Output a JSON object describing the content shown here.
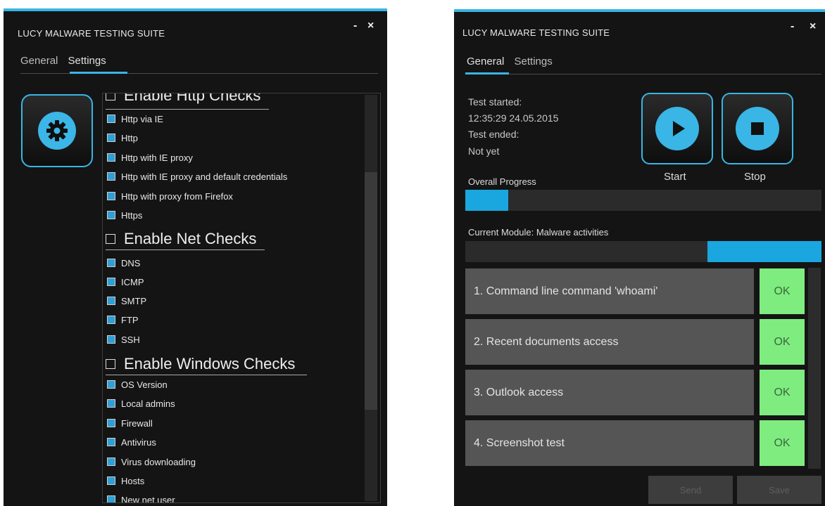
{
  "left_window": {
    "title": "LUCY MALWARE TESTING SUITE",
    "minimize": "-",
    "close": "×",
    "tabs": [
      {
        "label": "General"
      },
      {
        "label": "Settings"
      }
    ],
    "active_tab": "Settings",
    "settings_icon": "gear-icon",
    "sections": [
      {
        "header": "Enable Http Checks",
        "enabled": false,
        "items": [
          {
            "label": "Http via IE",
            "checked": true
          },
          {
            "label": "Http",
            "checked": true
          },
          {
            "label": "Http with IE proxy",
            "checked": true
          },
          {
            "label": "Http with IE proxy and default credentials",
            "checked": true
          },
          {
            "label": "Http with proxy from Firefox",
            "checked": true
          },
          {
            "label": "Https",
            "checked": true
          }
        ]
      },
      {
        "header": "Enable Net Checks",
        "enabled": false,
        "items": [
          {
            "label": "DNS",
            "checked": true
          },
          {
            "label": "ICMP",
            "checked": true
          },
          {
            "label": "SMTP",
            "checked": true
          },
          {
            "label": "FTP",
            "checked": true
          },
          {
            "label": "SSH",
            "checked": true
          }
        ]
      },
      {
        "header": "Enable Windows Checks",
        "enabled": false,
        "items": [
          {
            "label": "OS Version",
            "checked": true
          },
          {
            "label": "Local admins",
            "checked": true
          },
          {
            "label": "Firewall",
            "checked": true
          },
          {
            "label": "Antivirus",
            "checked": true
          },
          {
            "label": "Virus downloading",
            "checked": true
          },
          {
            "label": "Hosts",
            "checked": true
          },
          {
            "label": "New net user",
            "checked": true
          }
        ]
      }
    ]
  },
  "right_window": {
    "title": "LUCY MALWARE TESTING SUITE",
    "minimize": "-",
    "close": "×",
    "tabs": [
      {
        "label": "General"
      },
      {
        "label": "Settings"
      }
    ],
    "active_tab": "General",
    "test_started_label": "Test started:",
    "test_started_value": "12:35:29 24.05.2015",
    "test_ended_label": "Test ended:",
    "test_ended_value": "Not yet",
    "start_label": "Start",
    "stop_label": "Stop",
    "start_icon": "play-icon",
    "stop_icon": "stop-icon",
    "overall_progress_label": "Overall Progress",
    "overall_progress": 0.12,
    "current_module_label": "Current Module: Malware activities",
    "current_module_progress": 0.32,
    "modules": [
      {
        "label": "1. Command line command 'whoami'",
        "status": "OK"
      },
      {
        "label": "2. Recent documents access",
        "status": "OK"
      },
      {
        "label": "3. Outlook access",
        "status": "OK"
      },
      {
        "label": "4. Screenshot test",
        "status": "OK"
      }
    ],
    "footer_buttons": [
      {
        "label": "Send"
      },
      {
        "label": "Save"
      }
    ]
  },
  "colors": {
    "accent": "#39b5e6",
    "background": "#141414",
    "ok_green": "#7fec7f",
    "module_row": "#555555"
  }
}
